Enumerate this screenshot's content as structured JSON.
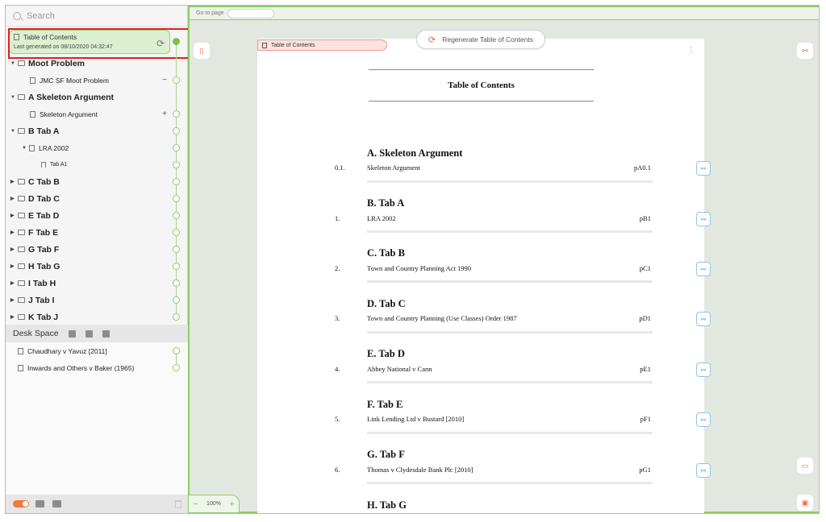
{
  "sidebar": {
    "search_placeholder": "Search",
    "toc": {
      "title": "Table of Contents",
      "subtitle": "Last generated on 08/10/2020 04:32:47"
    },
    "tree": [
      {
        "label": "Moot Problem",
        "level": 0
      },
      {
        "label": "JMC SF Moot Problem",
        "level": 1,
        "action": "−"
      },
      {
        "label": "A Skeleton Argument",
        "level": 0
      },
      {
        "label": "Skeleton Argument",
        "level": 1,
        "action": "+"
      },
      {
        "label": "B Tab A",
        "level": 0
      },
      {
        "label": "LRA 2002",
        "level": 1
      },
      {
        "label": "Tab A1",
        "level": 2
      },
      {
        "label": "C Tab B",
        "level": 0
      },
      {
        "label": "D Tab C",
        "level": 0
      },
      {
        "label": "E Tab D",
        "level": 0
      },
      {
        "label": "F Tab E",
        "level": 0
      },
      {
        "label": "G Tab F",
        "level": 0
      },
      {
        "label": "H Tab G",
        "level": 0
      },
      {
        "label": "I Tab H",
        "level": 0
      },
      {
        "label": "J Tab I",
        "level": 0
      },
      {
        "label": "K Tab J",
        "level": 0
      }
    ],
    "desk_space": {
      "label": "Desk Space",
      "items": [
        "Chaudhary v Yavuz [2011]",
        "Inwards and Others v Baker (1965)"
      ]
    }
  },
  "main": {
    "goto_label": "Go to page",
    "zoom_label": "100%",
    "page_tab_label": "Table of Contents",
    "regen_label": "Regenerate Table of Contents",
    "doc_title": "Table of Contents",
    "sections": [
      {
        "heading": "A. Skeleton Argument",
        "num": "0.1.",
        "name": "Skeleton Argument",
        "page": "pA0.1"
      },
      {
        "heading": "B. Tab A",
        "num": "1.",
        "name": "LRA 2002",
        "page": "pB1"
      },
      {
        "heading": "C. Tab B",
        "num": "2.",
        "name": "Town and Country Planning Act 1990",
        "page": "pC1"
      },
      {
        "heading": "D. Tab C",
        "num": "3.",
        "name": "Town and Country Planning (Use Classes) Order 1987",
        "page": "pD1"
      },
      {
        "heading": "E. Tab D",
        "num": "4.",
        "name": "Abbey National v Cann",
        "page": "pE1"
      },
      {
        "heading": "F. Tab E",
        "num": "5.",
        "name": "Link Lending Ltd v Bustard [2010]",
        "page": "pF1"
      },
      {
        "heading": "G. Tab F",
        "num": "6.",
        "name": "Thomas v Clydesdale Bank Plc [2010]",
        "page": "pG1"
      },
      {
        "heading": "H. Tab G"
      }
    ]
  },
  "icons": {
    "search": "search-icon",
    "refresh": "refresh-icon",
    "link": "link-icon",
    "bookmark": "bookmark-icon",
    "comment": "comment-icon"
  },
  "colors": {
    "accent_green": "#8fcb68",
    "accent_orange": "#e86a3a",
    "highlight_red": "#e02020",
    "link_blue": "#5aa8d8"
  }
}
